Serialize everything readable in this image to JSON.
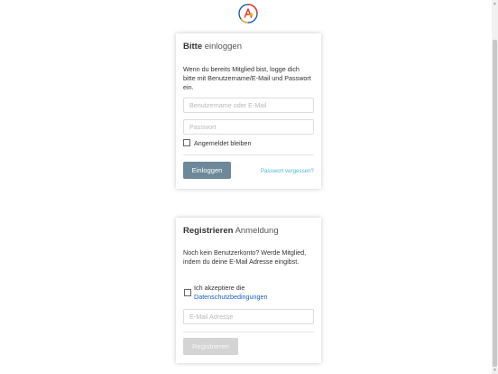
{
  "login": {
    "title_bold": "Bitte",
    "title_light": "einloggen",
    "description": "Wenn du bereits Mitglied bist, logge dich bitte mit Benutzername/E-Mail und Passwort ein.",
    "username_placeholder": "Benutzername oder E-Mail",
    "password_placeholder": "Passwort",
    "remember_label": "Angemeldet bleiben",
    "submit_label": "Einloggen",
    "forgot_label": "Passwort vergessen?"
  },
  "register": {
    "title_bold": "Registrieren",
    "title_light": "Anmeldung",
    "description": "Noch kein Benutzerkonto? Werde Mitglied, indem du deine E-Mail Adresse eingibst.",
    "accept_prefix": "Ich akzeptiere die",
    "accept_link": "Datenschutzbedingungen",
    "email_placeholder": "E-Mail Adresse",
    "submit_label": "Registrieren"
  },
  "colors": {
    "login_button": "#6d8899",
    "register_button_disabled": "#d4d4d4",
    "link_blue": "#1a5dc7",
    "forgot_link": "#4fb3d8"
  },
  "icons": {
    "logo": "circular-a-star-logo-icon"
  }
}
